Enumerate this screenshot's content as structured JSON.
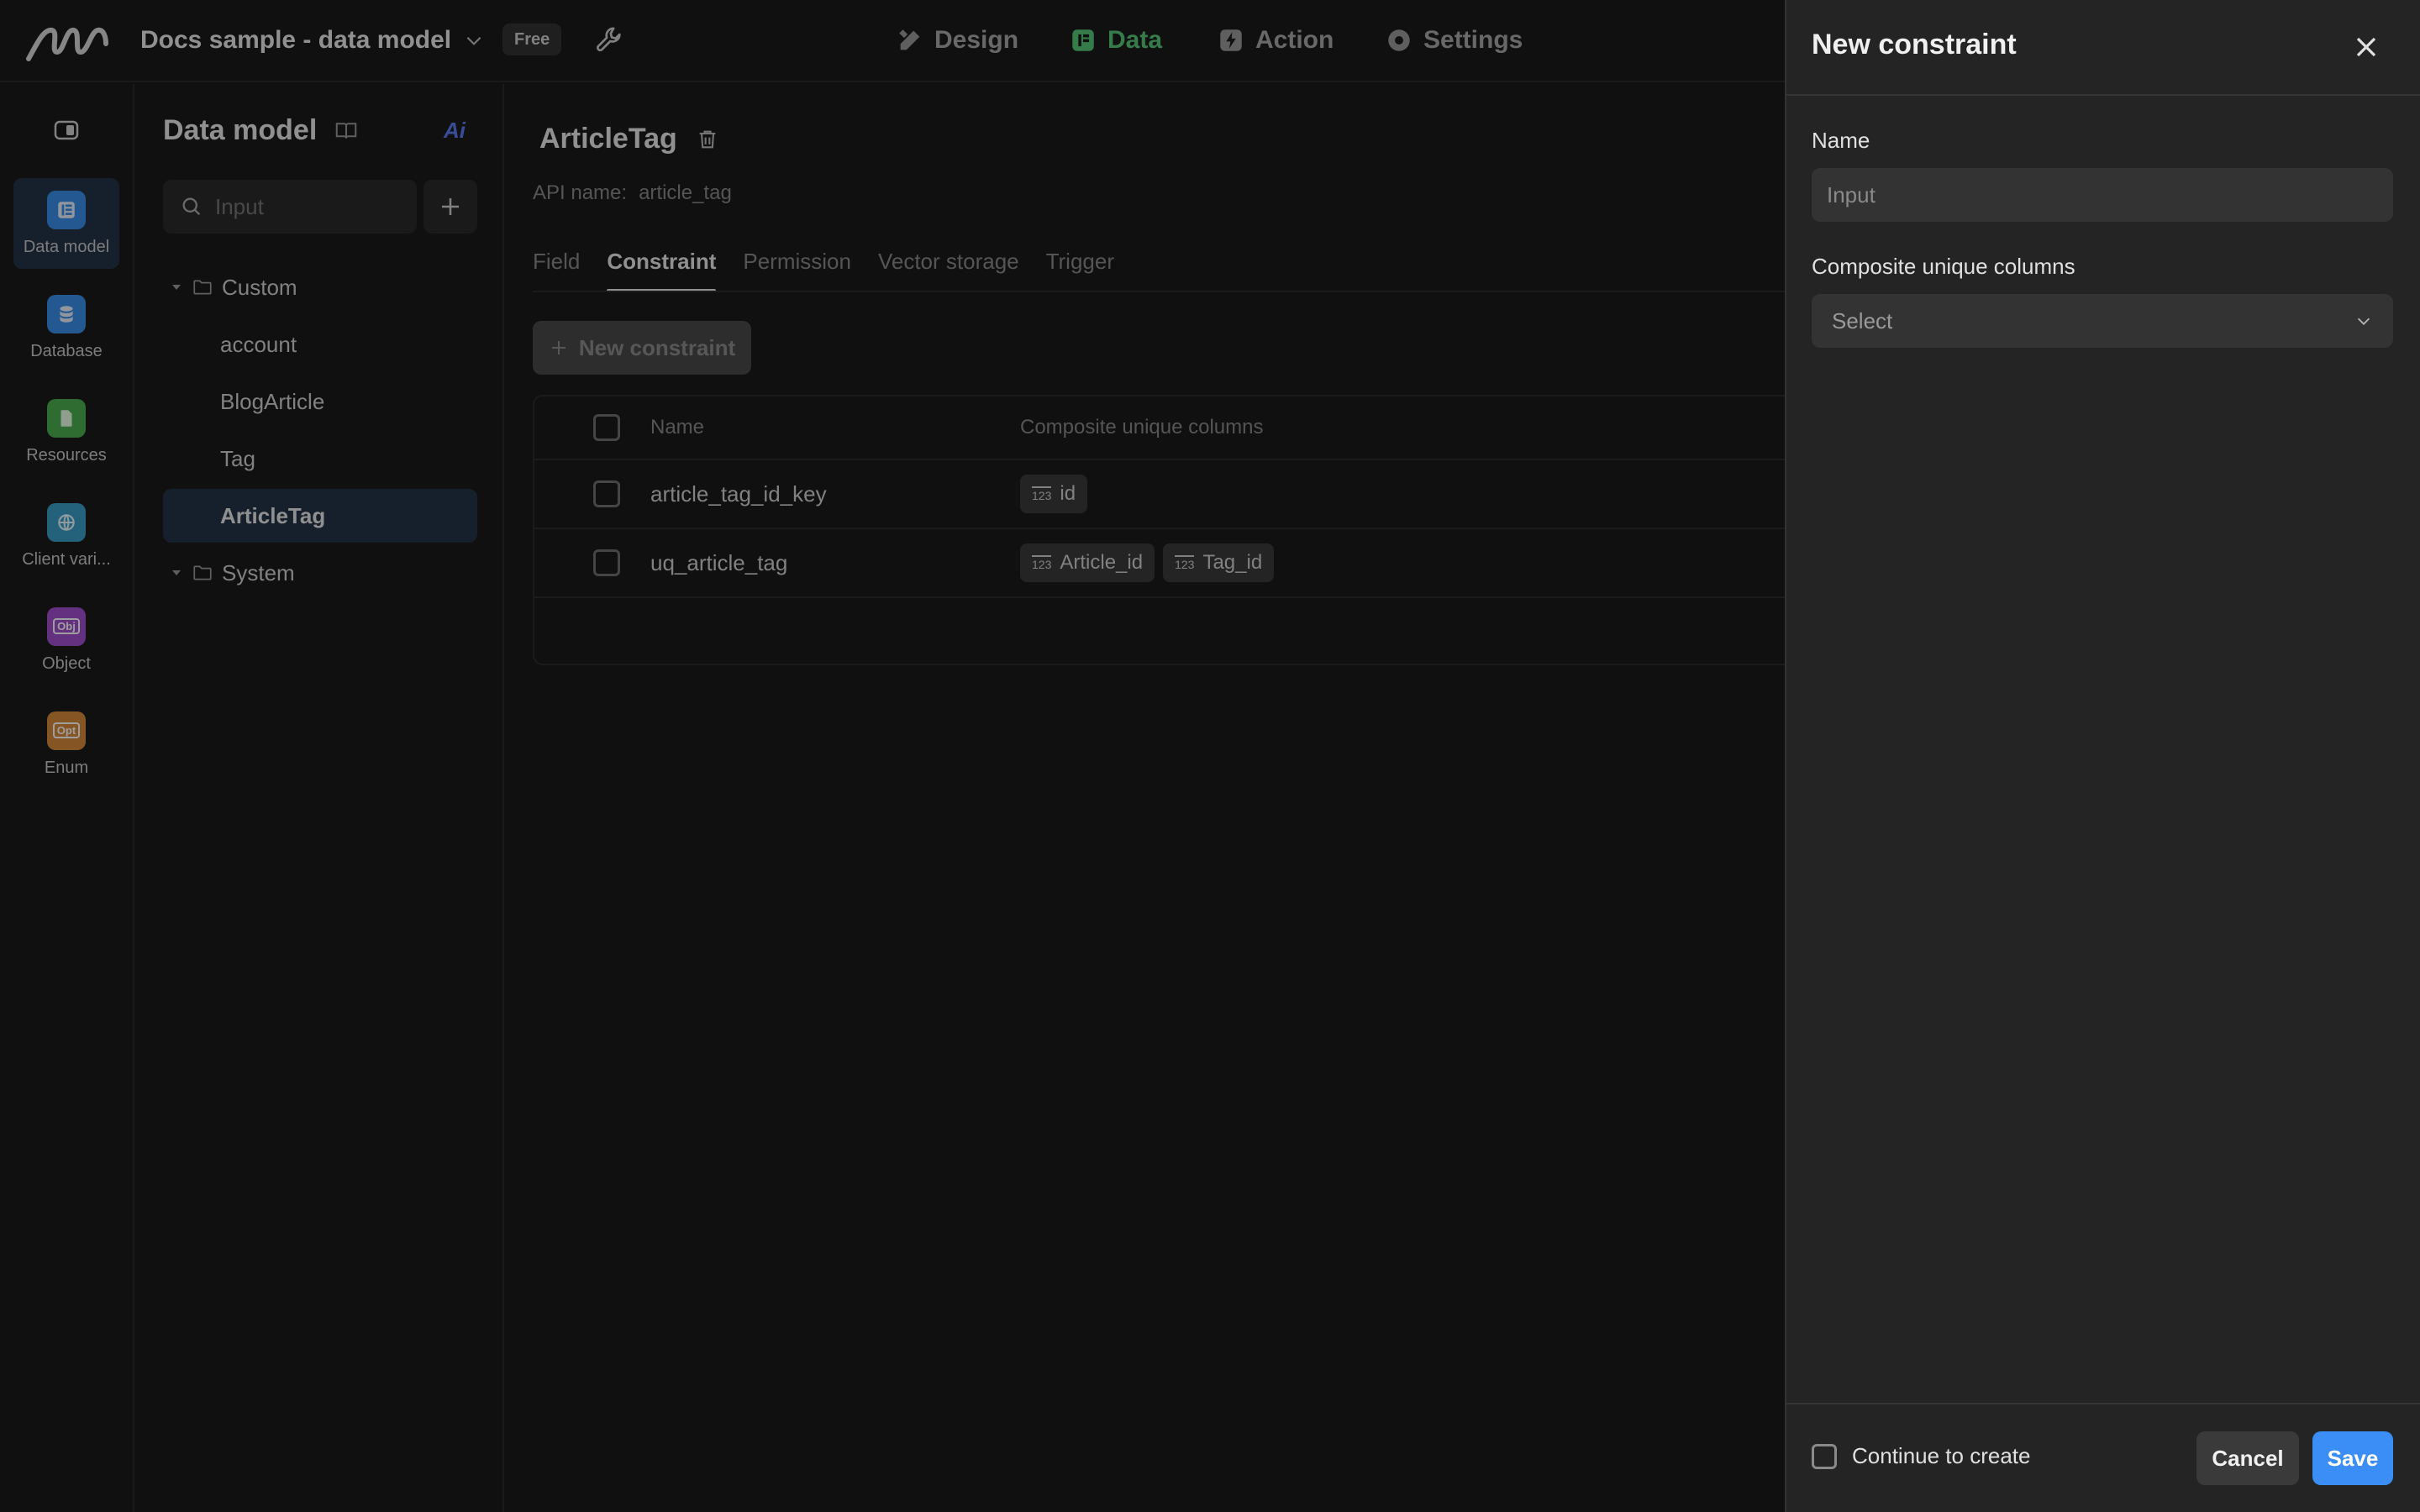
{
  "app": {
    "title": "Docs sample - data model",
    "plan_badge": "Free"
  },
  "top_nav": [
    {
      "label": "Design",
      "icon": "pencil-ruler-icon",
      "active": false
    },
    {
      "label": "Data",
      "icon": "data-icon",
      "active": true
    },
    {
      "label": "Action",
      "icon": "bolt-icon",
      "active": false
    },
    {
      "label": "Settings",
      "icon": "gear-icon",
      "active": false
    }
  ],
  "rail": [
    {
      "label": "Data model",
      "icon": "table-icon",
      "color": "#3a8ee8",
      "active": true
    },
    {
      "label": "Database",
      "icon": "database-icon",
      "color": "#3a8ee8",
      "active": false
    },
    {
      "label": "Resources",
      "icon": "file-icon",
      "color": "#4caf50",
      "active": false
    },
    {
      "label": "Client vari...",
      "icon": "globe-icon",
      "color": "#3a9fc8",
      "active": false
    },
    {
      "label": "Object",
      "icon": "object-icon",
      "icon_text": "Obj",
      "color": "#a24fcf",
      "active": false
    },
    {
      "label": "Enum",
      "icon": "enum-icon",
      "icon_text": "Opt",
      "color": "#d98a3a",
      "active": false
    }
  ],
  "tree": {
    "title": "Data model",
    "ai_label": "Ai",
    "search_placeholder": "Input",
    "folders": [
      {
        "label": "Custom",
        "items": [
          "account",
          "BlogArticle",
          "Tag",
          "ArticleTag"
        ]
      },
      {
        "label": "System",
        "items": []
      }
    ],
    "selected": "ArticleTag"
  },
  "entity": {
    "title": "ArticleTag",
    "api_label": "API name:",
    "api_value": "article_tag"
  },
  "tabs": [
    {
      "label": "Field",
      "active": false
    },
    {
      "label": "Constraint",
      "active": true
    },
    {
      "label": "Permission",
      "active": false
    },
    {
      "label": "Vector storage",
      "active": false
    },
    {
      "label": "Trigger",
      "active": false
    }
  ],
  "new_constraint_button": "New constraint",
  "table": {
    "columns": [
      "Name",
      "Composite unique columns"
    ],
    "rows": [
      {
        "name": "article_tag_id_key",
        "columns": [
          "id"
        ]
      },
      {
        "name": "uq_article_tag",
        "columns": [
          "Article_id",
          "Tag_id"
        ]
      }
    ],
    "chip_icon_text": "123"
  },
  "drawer": {
    "title": "New constraint",
    "name_label": "Name",
    "name_placeholder": "Input",
    "columns_label": "Composite unique columns",
    "columns_placeholder": "Select",
    "continue_label": "Continue to create",
    "cancel_label": "Cancel",
    "save_label": "Save"
  },
  "colors": {
    "accent_green": "#57c87a",
    "primary_blue": "#3a8ef6",
    "selection": "#25344a"
  }
}
